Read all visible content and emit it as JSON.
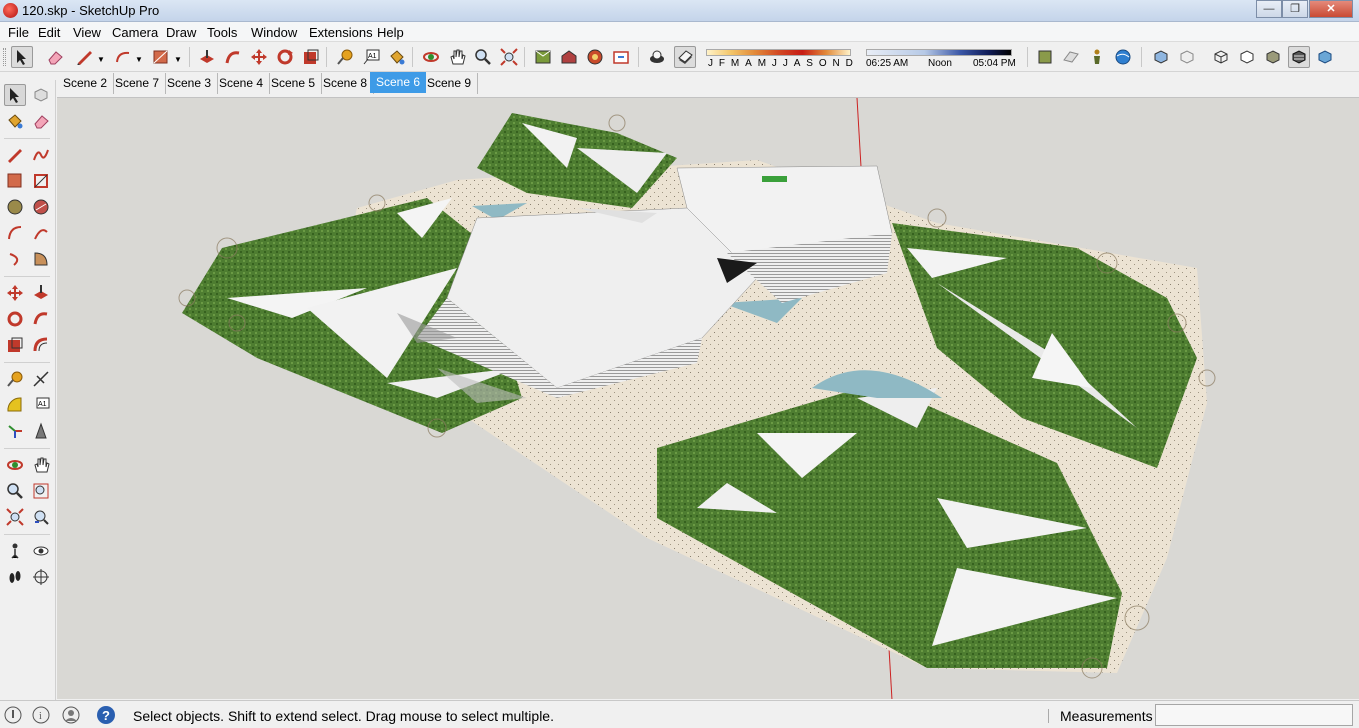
{
  "window": {
    "title": "120.skp - SketchUp Pro"
  },
  "menu": [
    "File",
    "Edit",
    "View",
    "Camera",
    "Draw",
    "Tools",
    "Window",
    "Extensions",
    "Help"
  ],
  "shadows": {
    "months": [
      "J",
      "F",
      "M",
      "A",
      "M",
      "J",
      "J",
      "A",
      "S",
      "O",
      "N",
      "D"
    ],
    "time_start": "06:25 AM",
    "time_mid": "Noon",
    "time_end": "05:04 PM"
  },
  "scenes": [
    "Scene 2",
    "Scene 7",
    "Scene 3",
    "Scene 4",
    "Scene 5",
    "Scene 8",
    "Scene 6",
    "Scene 9"
  ],
  "active_scene": "Scene 6",
  "status": {
    "message": "Select objects. Shift to extend select. Drag mouse to select multiple.",
    "measurements_label": "Measurements",
    "measurements_value": ""
  },
  "colors": {
    "sky": "#d9d8d4",
    "grass": "#4b7a2e",
    "paving": "#eae0cf",
    "water": "#8fb9c4",
    "scene_active": "#3e9be7"
  }
}
